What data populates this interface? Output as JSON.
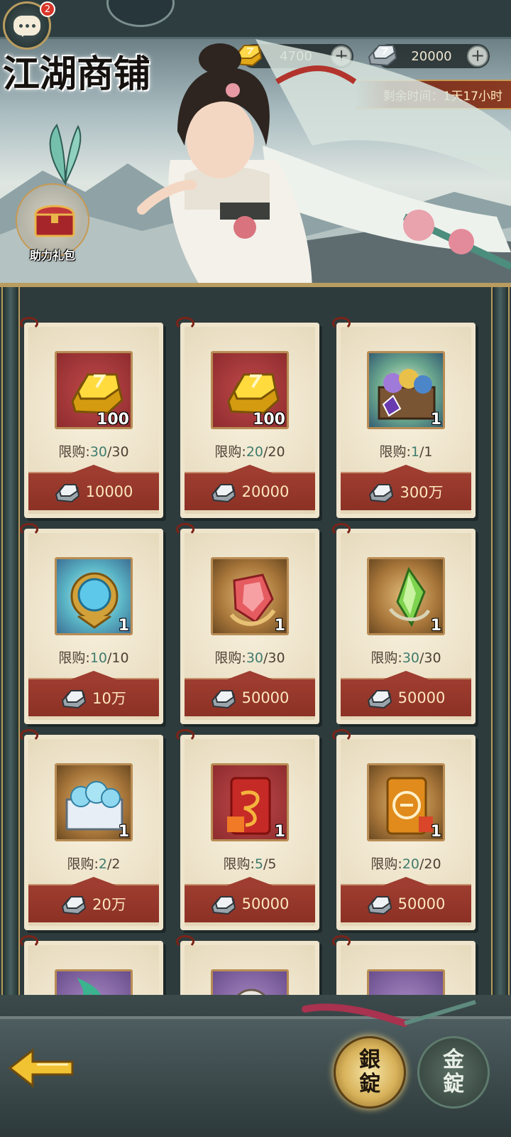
{
  "header": {
    "title": "江湖商铺",
    "chat_badge": "2",
    "currencies": [
      {
        "name": "gold-ingot",
        "value": "4700",
        "color": "#f1c232"
      },
      {
        "name": "silver-ingot",
        "value": "20000",
        "color": "#d6dde2"
      }
    ],
    "timer_text": "剩余时间：1天17小时",
    "gift_pack_label": "助力礼包"
  },
  "shop": {
    "limit_prefix": "限购:",
    "items": [
      {
        "icon": "gold-ingot-icon",
        "bg": "red",
        "qty": "100",
        "limit_current": "30",
        "limit_total": "/30",
        "price": "10000"
      },
      {
        "icon": "gold-ingot-icon",
        "bg": "red",
        "qty": "100",
        "limit_current": "20",
        "limit_total": "/20",
        "price": "20000"
      },
      {
        "icon": "gem-chest-icon",
        "bg": "green",
        "qty": "1",
        "limit_current": "1",
        "limit_total": "/1",
        "price": "300万"
      },
      {
        "icon": "blue-orb-charm-icon",
        "bg": "blue",
        "qty": "1",
        "limit_current": "10",
        "limit_total": "/10",
        "price": "10万"
      },
      {
        "icon": "red-crystal-icon",
        "bg": "brown",
        "qty": "1",
        "limit_current": "30",
        "limit_total": "/30",
        "price": "50000"
      },
      {
        "icon": "green-crystal-icon",
        "bg": "brown",
        "qty": "1",
        "limit_current": "30",
        "limit_total": "/30",
        "price": "50000"
      },
      {
        "icon": "crystal-box-icon",
        "bg": "brown",
        "qty": "1",
        "limit_current": "2",
        "limit_total": "/2",
        "price": "20万"
      },
      {
        "icon": "red-dragon-token-icon",
        "bg": "red",
        "qty": "1",
        "limit_current": "5",
        "limit_total": "/5",
        "price": "50000"
      },
      {
        "icon": "gold-token-icon",
        "bg": "brown",
        "qty": "1",
        "limit_current": "20",
        "limit_total": "/20",
        "price": "50000"
      },
      {
        "icon": "green-serpent-icon",
        "bg": "purple",
        "qty": "",
        "limit_current": "",
        "limit_total": "",
        "price": ""
      },
      {
        "icon": "white-beast-icon",
        "bg": "purple",
        "qty": "",
        "limit_current": "",
        "limit_total": "",
        "price": ""
      },
      {
        "icon": "gold-coins-icon",
        "bg": "purple",
        "qty": "",
        "limit_current": "",
        "limit_total": "",
        "price": ""
      }
    ]
  },
  "tabs": [
    {
      "label": "銀錠",
      "active": true
    },
    {
      "label": "金錠",
      "active": false
    }
  ],
  "colors": {
    "accent_gold": "#b99c5f",
    "price_red": "#8c3125",
    "limit_green": "#3f7c6e"
  }
}
